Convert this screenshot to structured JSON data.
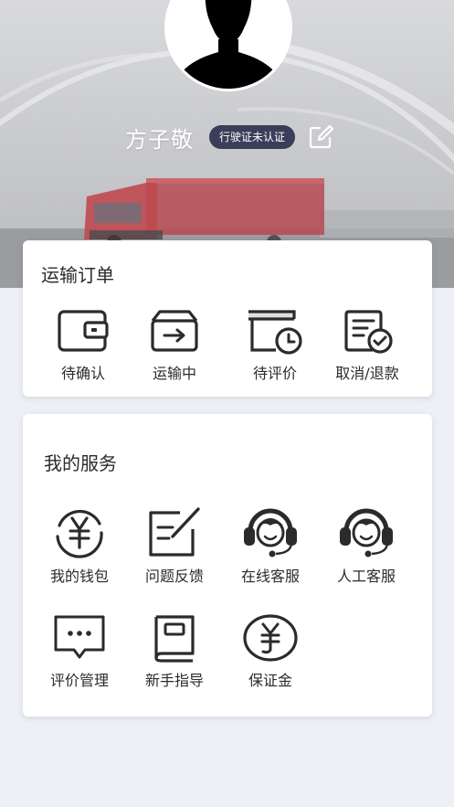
{
  "profile": {
    "name": "方子敬",
    "license_badge": "行驶证未认证"
  },
  "orders": {
    "title": "运输订单",
    "items": [
      {
        "label": "待确认",
        "icon": "wallet-icon"
      },
      {
        "label": "运输中",
        "icon": "transit-arrow-icon"
      },
      {
        "label": "待评价",
        "icon": "pending-clock-icon"
      },
      {
        "label": "取消/退款",
        "icon": "document-check-icon"
      }
    ]
  },
  "services": {
    "title": "我的服务",
    "items": [
      {
        "label": "我的钱包",
        "icon": "yen-coin-icon"
      },
      {
        "label": "问题反馈",
        "icon": "feedback-edit-icon"
      },
      {
        "label": "在线客服",
        "icon": "headset-agent-icon"
      },
      {
        "label": "人工客服",
        "icon": "headset-agent-icon"
      },
      {
        "label": "评价管理",
        "icon": "chat-bubble-icon"
      },
      {
        "label": "新手指导",
        "icon": "guide-book-icon"
      },
      {
        "label": "保证金",
        "icon": "yen-deposit-icon"
      }
    ]
  },
  "colors": {
    "badge_bg": "#3a3e58",
    "page_bg": "#eef0f7",
    "icon_stroke": "#2b2b2b"
  }
}
